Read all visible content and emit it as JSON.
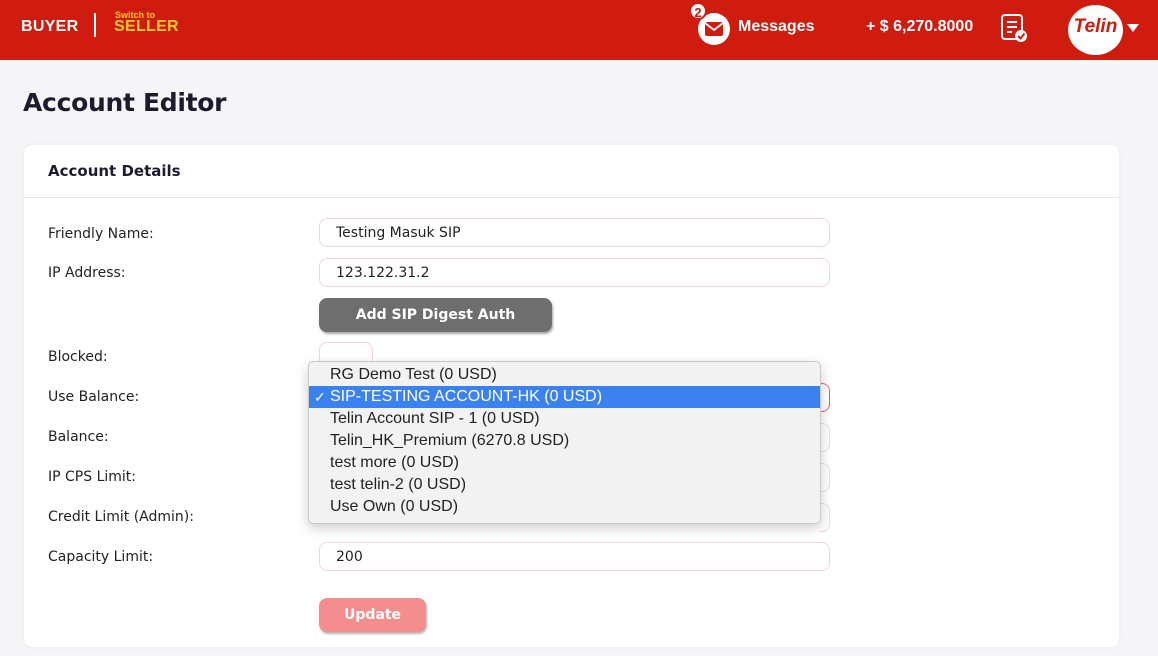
{
  "topbar": {
    "buyer_label": "BUYER",
    "switch_to_label": "Switch to",
    "seller_label": "SELLER",
    "messages_count": "2",
    "messages_label": "Messages",
    "balance": "+ $ 6,270.8000",
    "avatar_text": "Telin"
  },
  "page": {
    "title": "Account Editor"
  },
  "card": {
    "title": "Account Details",
    "labels": {
      "friendly_name": "Friendly Name:",
      "ip_address": "IP Address:",
      "blocked": "Blocked:",
      "use_balance": "Use Balance:",
      "balance": "Balance:",
      "ip_cps_limit": "IP CPS Limit:",
      "credit_limit": "Credit Limit (Admin):",
      "capacity_limit": "Capacity Limit:"
    },
    "values": {
      "friendly_name": "Testing Masuk SIP",
      "ip_address": "123.122.31.2",
      "capacity_limit": "200"
    },
    "sip_button_label": "Add SIP Digest Auth",
    "update_button_label": "Update"
  },
  "dropdown": {
    "selected_index": 1,
    "options": [
      "RG Demo Test (0 USD)",
      "SIP-TESTING ACCOUNT-HK (0 USD)",
      "Telin Account SIP - 1 (0 USD)",
      "Telin_HK_Premium (6270.8 USD)",
      "test more (0 USD)",
      "test telin-2 (0 USD)",
      "Use Own (0 USD)"
    ]
  },
  "colors": {
    "brand_red": "#d01b0f",
    "accent_yellow": "#fbc92b",
    "selected_blue": "#3b82f0"
  }
}
